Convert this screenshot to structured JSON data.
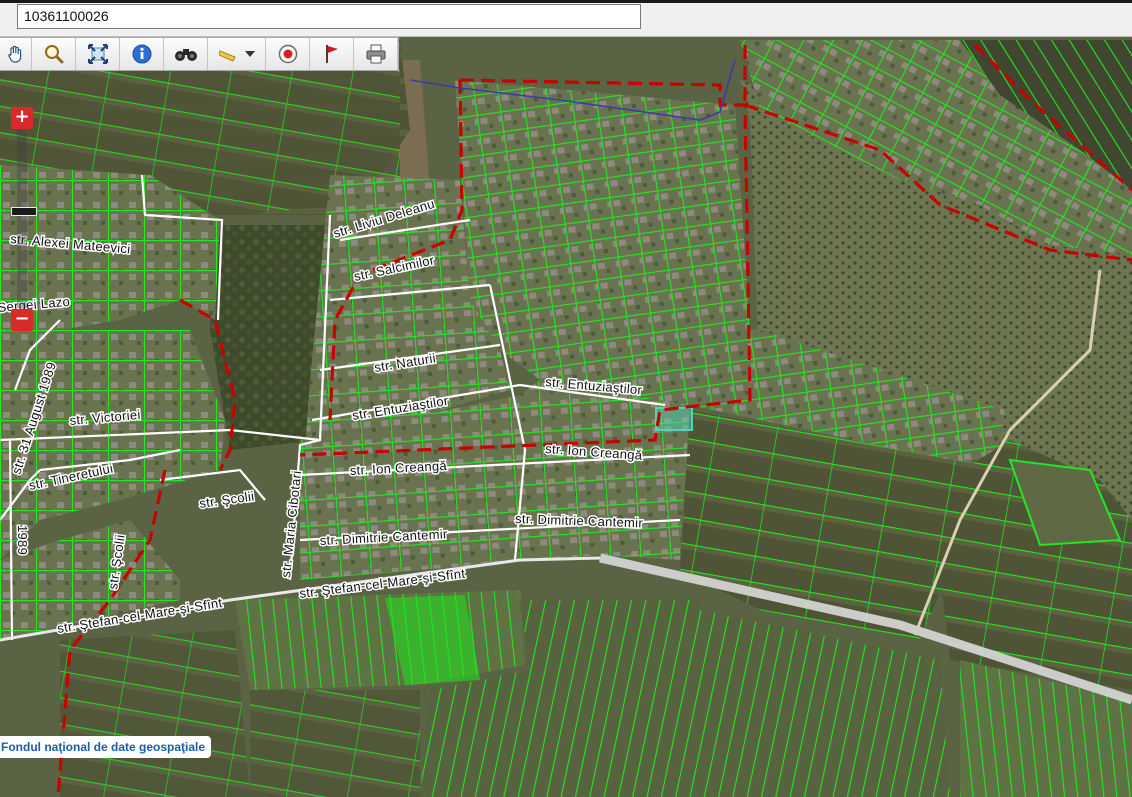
{
  "search": {
    "value": "10361100026"
  },
  "toolbar": {
    "tools": [
      {
        "name": "pan-hand-icon"
      },
      {
        "name": "zoom-magnifier-icon"
      },
      {
        "name": "full-extent-icon"
      },
      {
        "name": "info-icon"
      },
      {
        "name": "binoculars-icon"
      },
      {
        "name": "measure-ruler-icon"
      },
      {
        "name": "record-target-icon"
      },
      {
        "name": "flag-icon"
      },
      {
        "name": "print-icon"
      }
    ]
  },
  "zoom": {
    "plus": "+",
    "minus": "−"
  },
  "streets": [
    {
      "id": "liviu",
      "text": "str. Liviu Deleanu"
    },
    {
      "id": "salcimilor",
      "text": "str. Salcimilor"
    },
    {
      "id": "naturii",
      "text": "str. Naturii"
    },
    {
      "id": "entuz1",
      "text": "str. Entuziaştilor"
    },
    {
      "id": "entuz2",
      "text": "str. Entuziaştilor"
    },
    {
      "id": "creanga1",
      "text": "str. Ion Creangă"
    },
    {
      "id": "creanga2",
      "text": "str. Ion Creangă"
    },
    {
      "id": "cantemir1",
      "text": "str. Dimitrie Cantemir"
    },
    {
      "id": "cantemir2",
      "text": "str. Dimitrie Cantemir"
    },
    {
      "id": "stefan1",
      "text": "str. Ştefan-cel-Mare-şi-Sfînt"
    },
    {
      "id": "stefan2",
      "text": "str. Ştefan-cel-Mare-şi-Sfînt"
    },
    {
      "id": "mateevici",
      "text": "str. Alexei Mateevici"
    },
    {
      "id": "lazo",
      "text": "Sergei Lazo"
    },
    {
      "id": "august",
      "text": "str. 31 August 1989"
    },
    {
      "id": "victoriei",
      "text": "str. Victoriei"
    },
    {
      "id": "tineretului",
      "text": "str. Tineretului"
    },
    {
      "id": "scolii1",
      "text": "str. Şcolii"
    },
    {
      "id": "scolii2",
      "text": "str. Şcolii"
    },
    {
      "id": "cibotari",
      "text": "str. Maria Cibotari"
    },
    {
      "id": "leftcut",
      "text": "1989"
    }
  ],
  "attribution": "Fondul naţional de date geospaţiale",
  "colors": {
    "parcel": "#22e622",
    "boundary": "#c80000",
    "road": "#ffffff",
    "selected": "#4fd6b8"
  }
}
